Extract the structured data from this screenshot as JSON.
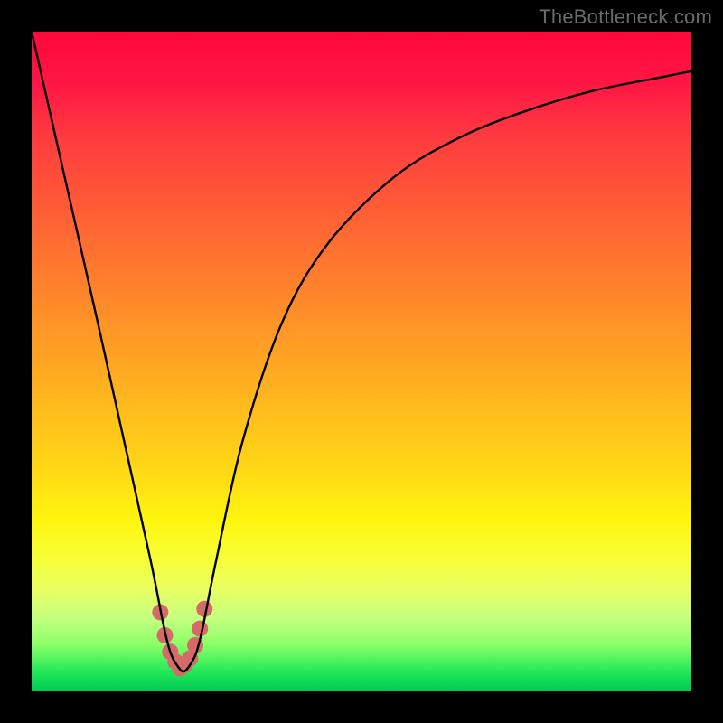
{
  "watermark": "TheBottleneck.com",
  "chart_data": {
    "type": "line",
    "title": "",
    "xlabel": "",
    "ylabel": "",
    "xlim": [
      0,
      100
    ],
    "ylim": [
      0,
      100
    ],
    "grid": false,
    "legend": false,
    "series": [
      {
        "name": "bottleneck-curve",
        "x": [
          0,
          5,
          10,
          14,
          18,
          20,
          21,
          22,
          23,
          24,
          25,
          26,
          28,
          32,
          38,
          45,
          55,
          65,
          75,
          85,
          95,
          100
        ],
        "y": [
          100,
          78,
          56,
          38,
          20,
          10,
          6,
          4,
          3,
          4,
          6,
          10,
          20,
          38,
          56,
          68,
          78,
          84,
          88,
          91,
          93,
          94
        ]
      },
      {
        "name": "highlight-dots",
        "x": [
          19.5,
          20.2,
          21.0,
          21.8,
          22.5,
          23.2,
          24.0,
          24.8,
          25.5,
          26.2
        ],
        "y": [
          12.0,
          8.5,
          6.0,
          4.5,
          3.5,
          4.0,
          5.0,
          7.0,
          9.5,
          12.5
        ]
      }
    ],
    "notch": {
      "x": 23,
      "y": 3
    },
    "colors": {
      "curve": "#000000",
      "dots": "#d46a6a",
      "frame": "#000000"
    }
  }
}
